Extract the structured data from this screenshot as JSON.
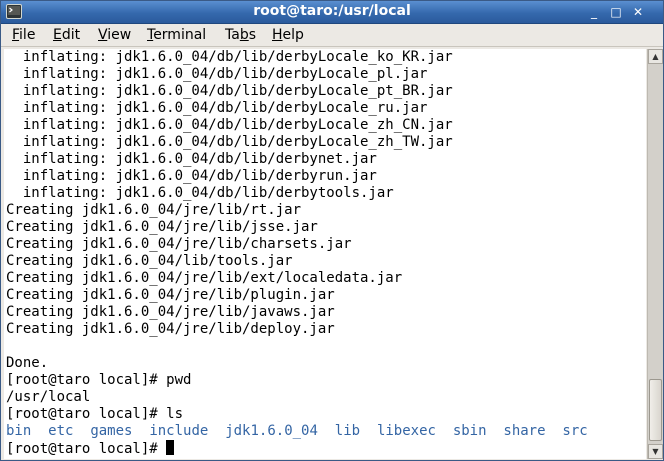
{
  "window": {
    "title": "root@taro:/usr/local",
    "buttons": {
      "minimize": "_",
      "maximize": "□",
      "close": "✕"
    },
    "icon": "terminal-icon"
  },
  "menu": [
    {
      "prefix": "",
      "accel": "F",
      "rest": "ile"
    },
    {
      "prefix": "",
      "accel": "E",
      "rest": "dit"
    },
    {
      "prefix": "",
      "accel": "V",
      "rest": "iew"
    },
    {
      "prefix": "",
      "accel": "T",
      "rest": "erminal"
    },
    {
      "prefix": "Ta",
      "accel": "b",
      "rest": "s"
    },
    {
      "prefix": "",
      "accel": "H",
      "rest": "elp"
    }
  ],
  "terminal": {
    "lines": [
      "  inflating: jdk1.6.0_04/db/lib/derbyLocale_ko_KR.jar",
      "  inflating: jdk1.6.0_04/db/lib/derbyLocale_pl.jar",
      "  inflating: jdk1.6.0_04/db/lib/derbyLocale_pt_BR.jar",
      "  inflating: jdk1.6.0_04/db/lib/derbyLocale_ru.jar",
      "  inflating: jdk1.6.0_04/db/lib/derbyLocale_zh_CN.jar",
      "  inflating: jdk1.6.0_04/db/lib/derbyLocale_zh_TW.jar",
      "  inflating: jdk1.6.0_04/db/lib/derbynet.jar",
      "  inflating: jdk1.6.0_04/db/lib/derbyrun.jar",
      "  inflating: jdk1.6.0_04/db/lib/derbytools.jar",
      "Creating jdk1.6.0_04/jre/lib/rt.jar",
      "Creating jdk1.6.0_04/jre/lib/jsse.jar",
      "Creating jdk1.6.0_04/jre/lib/charsets.jar",
      "Creating jdk1.6.0_04/lib/tools.jar",
      "Creating jdk1.6.0_04/jre/lib/ext/localedata.jar",
      "Creating jdk1.6.0_04/jre/lib/plugin.jar",
      "Creating jdk1.6.0_04/jre/lib/javaws.jar",
      "Creating jdk1.6.0_04/jre/lib/deploy.jar",
      "",
      "Done.",
      "[root@taro local]# pwd",
      "/usr/local",
      "[root@taro local]# ls"
    ],
    "ls_output": [
      "bin",
      "etc",
      "games",
      "include",
      "jdk1.6.0_04",
      "lib",
      "libexec",
      "sbin",
      "share",
      "src"
    ],
    "prompt": "[root@taro local]# ",
    "colors": {
      "background": "#ffffff",
      "text": "#000000",
      "directory": "#3465a4"
    }
  }
}
